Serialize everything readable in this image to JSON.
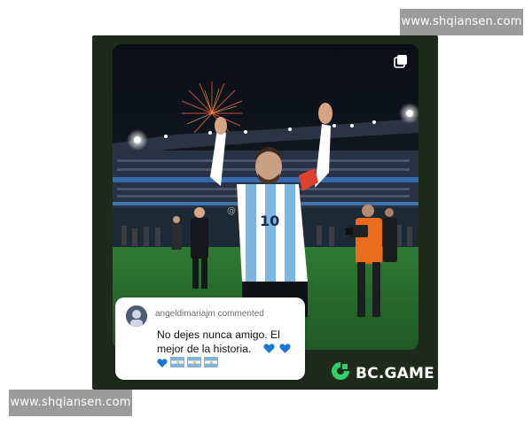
{
  "watermarks": {
    "top": "www.shqiansen.com",
    "bottom": "www.shqiansen.com"
  },
  "photo": {
    "overlay_handle": "@",
    "icons": {
      "multi_post": "copy-stack-icon"
    }
  },
  "comment": {
    "header": "angeldimariajm commented",
    "text": "No dejes nunca amigo. El mejor de la historia.",
    "emojis": [
      "blue-heart",
      "blue-heart",
      "blue-heart",
      "argentina-flag",
      "argentina-flag",
      "argentina-flag"
    ]
  },
  "brand": {
    "name": "BC.GAME",
    "accent": "#2fd16b"
  },
  "colors": {
    "frame": "#1e2b1a",
    "watermark_bg": "#9b9b9b",
    "jersey_blue": "#7db5e3",
    "heart_blue": "#1976d2"
  }
}
